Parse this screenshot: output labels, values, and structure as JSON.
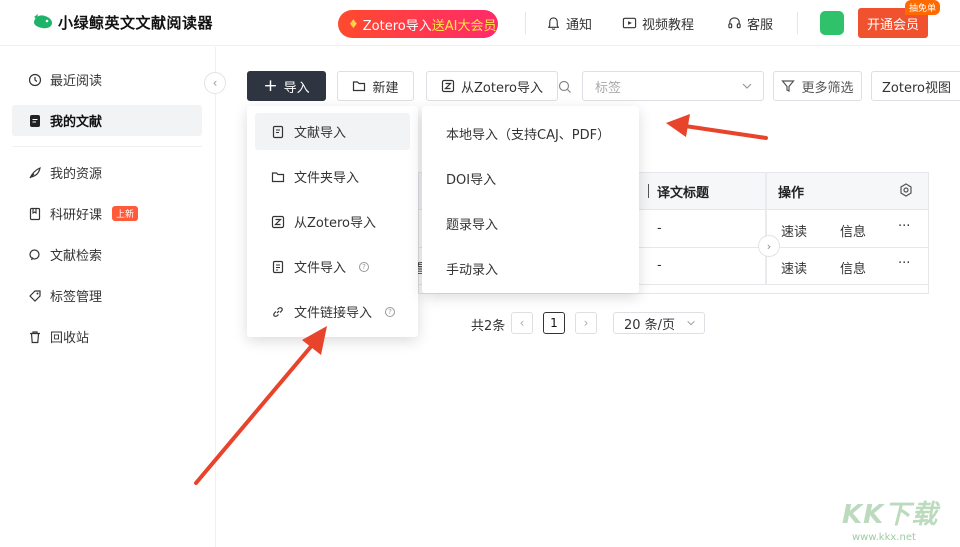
{
  "header": {
    "app_title": "小绿鲸英文文献阅读器",
    "promo": {
      "prefix": "Zotero导入",
      "highlight": "送AI大会员"
    },
    "notify": "通知",
    "tutorial": "视频教程",
    "service": "客服",
    "vip_button": "开通会员",
    "vip_badge": "抽免单"
  },
  "sidebar": {
    "collapse_icon": "‹",
    "items": [
      {
        "label": "最近阅读",
        "icon": "clock-icon"
      },
      {
        "label": "我的文献",
        "icon": "document-icon",
        "active": true
      },
      {
        "label": "我的资源",
        "icon": "feather-icon"
      },
      {
        "label": "科研好课",
        "icon": "book-icon",
        "badge": "上新"
      },
      {
        "label": "文献检索",
        "icon": "search-icon"
      },
      {
        "label": "标签管理",
        "icon": "tag-icon"
      },
      {
        "label": "回收站",
        "icon": "trash-icon"
      }
    ]
  },
  "toolbar": {
    "import": "导入",
    "new": "新建",
    "zotero_import": "从Zotero导入",
    "tag_placeholder": "标签",
    "more_filter": "更多筛选",
    "zotero_view": "Zotero视图"
  },
  "import_menu": {
    "items": [
      {
        "label": "文献导入",
        "icon": "doc-import-icon"
      },
      {
        "label": "文件夹导入",
        "icon": "folder-icon"
      },
      {
        "label": "从Zotero导入",
        "icon": "zotero-icon"
      },
      {
        "label": "文件导入",
        "icon": "file-icon",
        "help": "?"
      },
      {
        "label": "文件链接导入",
        "icon": "link-icon",
        "help": "?"
      }
    ]
  },
  "sub_menu": {
    "items": [
      "本地导入（支持CAJ、PDF）",
      "DOI导入",
      "题录导入",
      "手动录入"
    ]
  },
  "table": {
    "col_translated_title": "译文标题",
    "col_actions": "操作",
    "rows": [
      {
        "partial": "",
        "translated": "-",
        "quick_read": "速读",
        "info": "信息",
        "more": "···"
      },
      {
        "partial": "看",
        "translated": "-",
        "quick_read": "速读",
        "info": "信息",
        "more": "···"
      }
    ]
  },
  "pagination": {
    "total": "共2条",
    "prev": "‹",
    "current": "1",
    "next": "›",
    "page_size": "20 条/页"
  },
  "watermark": {
    "brand": "KK下载",
    "url": "www.kkx.net"
  }
}
